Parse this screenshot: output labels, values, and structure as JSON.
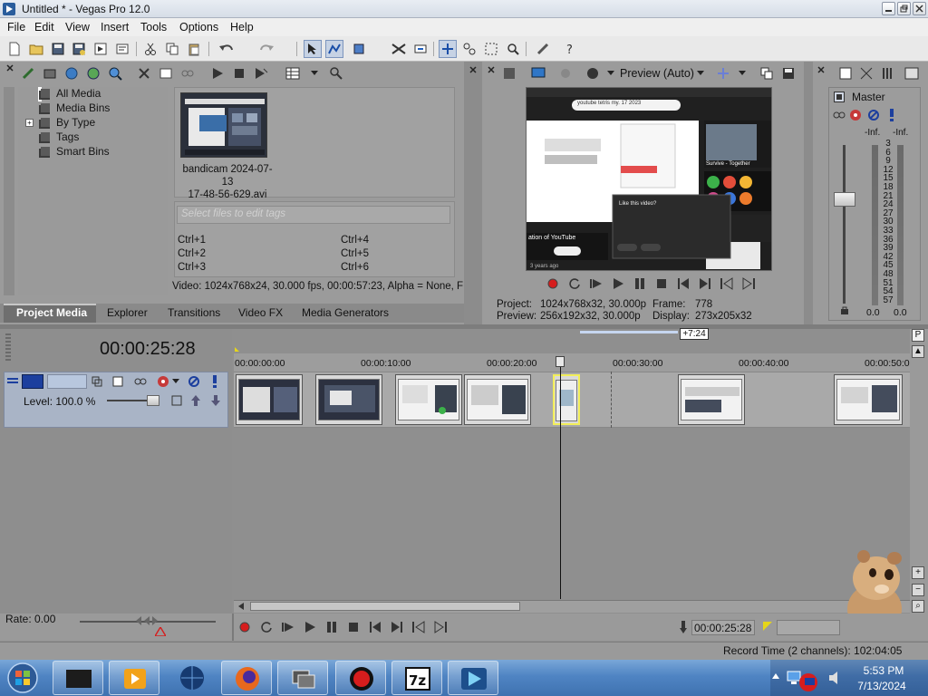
{
  "window": {
    "title": "Untitled * - Vegas Pro 12.0"
  },
  "menu": [
    "File",
    "Edit",
    "View",
    "Insert",
    "Tools",
    "Options",
    "Help"
  ],
  "project_media": {
    "tree": [
      "All Media",
      "Media Bins",
      "By Type",
      "Tags",
      "Smart Bins"
    ],
    "selected_tree_item": "All Media",
    "media_file": {
      "name_line1": "bandicam 2024-07-13",
      "name_line2": "17-48-56-629.avi"
    },
    "tag_placeholder": "Select files to edit tags",
    "tag_shortcuts": [
      "Ctrl+1",
      "Ctrl+4",
      "Ctrl+2",
      "Ctrl+5",
      "Ctrl+3",
      "Ctrl+6"
    ],
    "media_info": "Video: 1024x768x24, 30.000 fps, 00:00:57:23, Alpha = None, F"
  },
  "tabs": [
    "Project Media",
    "Explorer",
    "Transitions",
    "Video FX",
    "Media Generators"
  ],
  "active_tab": "Project Media",
  "preview": {
    "mode_label": "Preview (Auto)",
    "project_label": "Project:",
    "project_value": "1024x768x32, 30.000p",
    "preview_label": "Preview:",
    "preview_value": "256x192x32, 30.000p",
    "frame_label": "Frame:",
    "frame_value": "778",
    "display_label": "Display:",
    "display_value": "273x205x32",
    "screen": {
      "url_text": "youtube tetris my. 17 2023",
      "left_caption": "ation of YouTube",
      "dialog_title": "Like this video?",
      "bottom_caption": "3 years ago",
      "right_caption": "Survive - Together"
    }
  },
  "master": {
    "label": "Master",
    "inf_left": "-Inf.",
    "inf_right": "-Inf.",
    "scale": [
      "3",
      "6",
      "9",
      "12",
      "15",
      "18",
      "21",
      "24",
      "27",
      "30",
      "33",
      "36",
      "39",
      "42",
      "45",
      "48",
      "51",
      "54",
      "57"
    ],
    "bottom_left": "0.0",
    "bottom_right": "0.0"
  },
  "timeline": {
    "current_time": "00:00:25:28",
    "loop_length": "+7:24",
    "ruler": [
      "00:00:00:00",
      "00:00:10:00",
      "00:00:20:00",
      "00:00:30:00",
      "00:00:40:00",
      "00:00:50:00"
    ],
    "track_level": "Level: 100.0 %"
  },
  "transport": {
    "rate": "Rate: 0.00",
    "time": "00:00:25:28",
    "record_time": "Record Time (2 channels): 102:04:05"
  },
  "taskbar": {
    "time": "5:53 PM",
    "date": "7/13/2024"
  },
  "colors": {
    "track_header": "#a9b4c6",
    "taskbar": "#4f84c3",
    "record_red": "#d61d1d"
  }
}
